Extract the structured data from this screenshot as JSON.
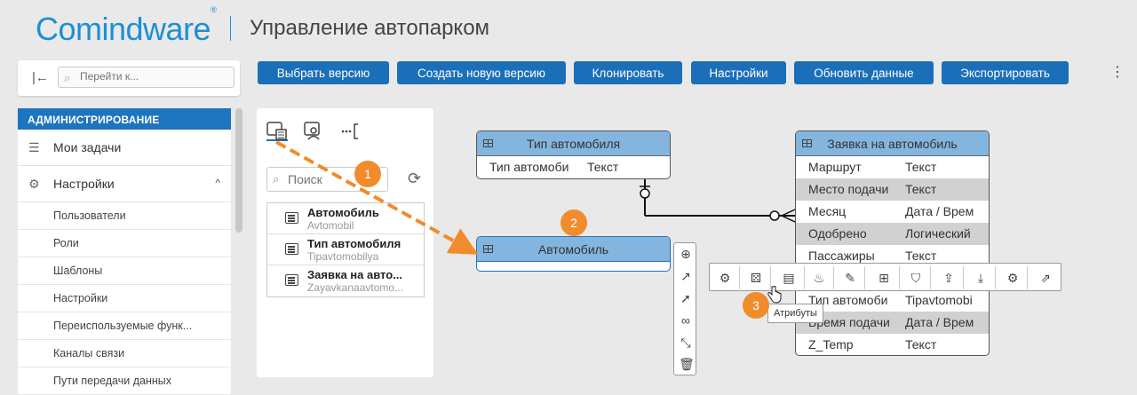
{
  "header": {
    "logo": "Comindware",
    "logo_mark": "®",
    "app_title": "Управление автопарком"
  },
  "nav": {
    "search_placeholder": "Перейти к..."
  },
  "sidebar": {
    "section_title": "АДМИНИСТРИРОВАНИЕ",
    "items": [
      {
        "label": "Мои задачи",
        "icon": "tasks-icon"
      },
      {
        "label": "Настройки",
        "icon": "gear-icon"
      }
    ],
    "subitems": [
      "Пользователи",
      "Роли",
      "Шаблоны",
      "Настройки",
      "Переиспользуемые функ...",
      "Каналы связи",
      "Пути передачи данных"
    ]
  },
  "toolbar": {
    "buttons": [
      "Выбрать версию",
      "Создать новую версию",
      "Клонировать",
      "Настройки",
      "Обновить данные",
      "Экспортировать"
    ]
  },
  "panel": {
    "search_placeholder": "Поиск",
    "templates": [
      {
        "name": "Автомобиль",
        "alias": "Avtomobil"
      },
      {
        "name": "Тип автомобиля",
        "alias": "Tipavtomobilya"
      },
      {
        "name": "Заявка на авто...",
        "alias": "Zayavkanaavtomo..."
      }
    ]
  },
  "diagram": {
    "entity_type": {
      "title": "Тип автомобиля",
      "rows": [
        {
          "name": "Тип автомоби",
          "type": "Текст"
        }
      ]
    },
    "entity_car": {
      "title": "Автомобиль"
    },
    "entity_request": {
      "title": "Заявка на автомобиль",
      "rows": [
        {
          "name": "Маршрут",
          "type": "Текст"
        },
        {
          "name": "Место подачи",
          "type": "Текст"
        },
        {
          "name": "Месяц",
          "type": "Дата / Врем"
        },
        {
          "name": "Одобрено",
          "type": "Логический"
        },
        {
          "name": "Пассажиры",
          "type": "Текст"
        },
        {
          "name": "",
          "type": ""
        },
        {
          "name": "Тип автомоби",
          "type": "Tipavtomobi"
        },
        {
          "name": "Время подачи",
          "type": "Дата / Врем"
        },
        {
          "name": "Z_Temp",
          "type": "Текст"
        }
      ]
    },
    "tooltip": "Атрибуты",
    "badges": [
      "1",
      "2",
      "3"
    ],
    "colors": {
      "accent": "#1b6fb8",
      "entity_header": "#83b5de",
      "badge": "#f08c2c"
    }
  }
}
